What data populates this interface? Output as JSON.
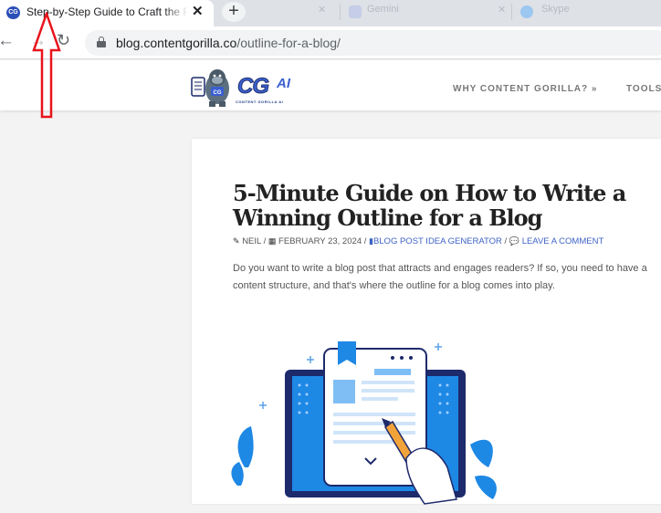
{
  "browser": {
    "active_tab": {
      "title": "Step-by-Step Guide to Craft the P",
      "favicon": "cg-favicon-icon"
    },
    "background_tabs": [
      {
        "title": "Gemini"
      },
      {
        "title": "Skype"
      }
    ],
    "new_tab_label": "+",
    "url": {
      "domain": "blog.contentgorilla.co",
      "path": "/outline-for-a-blog/"
    }
  },
  "site": {
    "logo": {
      "main": "CG",
      "suffix": "AI",
      "sub": "CONTENT GORILLA AI"
    },
    "nav": [
      {
        "label": "WHY CONTENT GORILLA? »"
      },
      {
        "label": "TOOLS"
      }
    ]
  },
  "article": {
    "title": "5-Minute Guide on How to Write a Winning Outline for a Blog",
    "meta": {
      "author": "NEIL",
      "date": "FEBRUARY 23, 2024",
      "category": "BLOG POST IDEA GENERATOR",
      "comment_link": "LEAVE A COMMENT",
      "separator": "/"
    },
    "excerpt": "Do you want to write a blog post that attracts and engages readers? If so, you need to have a content structure, and that's where the outline for a blog comes into play."
  },
  "annotation": {
    "color": "#e8141b",
    "points_to": "active-tab-title"
  },
  "colors": {
    "accent": "#3f63c5",
    "illustration_blue": "#1e88e5",
    "dark_navy": "#1d2a6b"
  }
}
